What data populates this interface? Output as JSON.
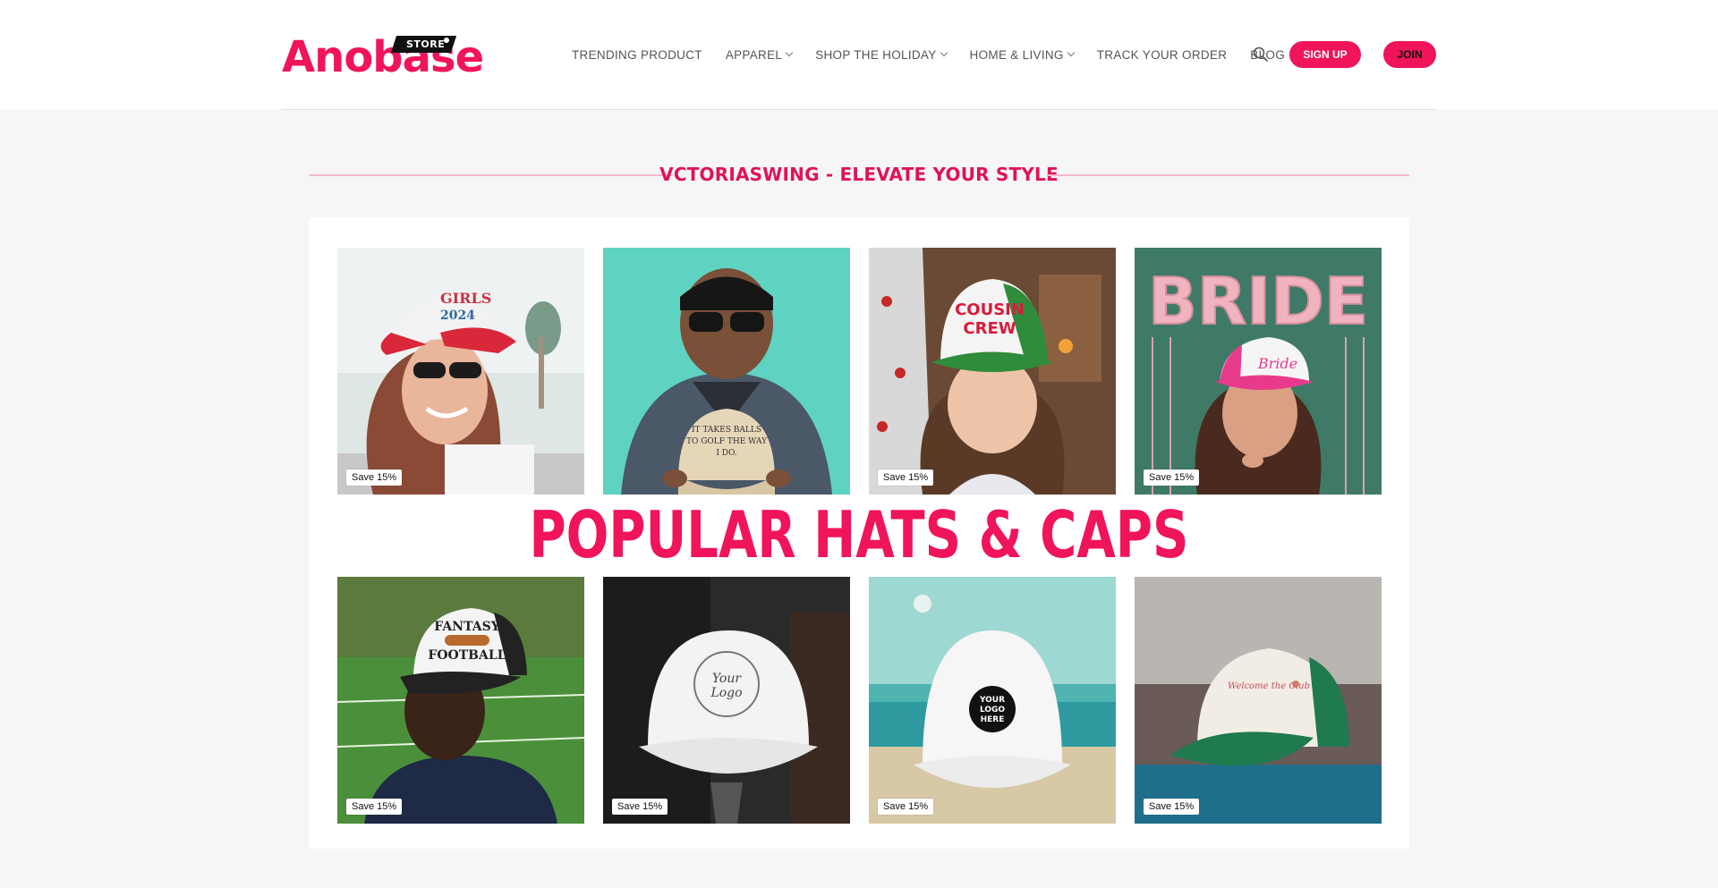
{
  "brand": {
    "name": "Anobase",
    "tag": "STORE"
  },
  "nav": [
    {
      "label": "TRENDING PRODUCT",
      "dropdown": false
    },
    {
      "label": "APPAREL",
      "dropdown": true
    },
    {
      "label": "SHOP THE HOLIDAY",
      "dropdown": true
    },
    {
      "label": "HOME & LIVING",
      "dropdown": true
    },
    {
      "label": "TRACK YOUR ORDER",
      "dropdown": false
    },
    {
      "label": "BLOG",
      "dropdown": false
    }
  ],
  "header": {
    "signup_label": "SIGN UP",
    "join_label": "JOIN",
    "search_icon": "search-icon"
  },
  "section": {
    "title": "VCTORIASWING - ELEVATE YOUR STYLE"
  },
  "banner": {
    "text": "POPULAR HATS & CAPS"
  },
  "products": [
    {
      "image": "woman-red-trucker-hat-girls-trip-2024",
      "badge": "Save 15%"
    },
    {
      "image": "man-holding-khaki-cap-golf-text",
      "badge": ""
    },
    {
      "image": "woman-green-trucker-cousin-crew",
      "badge": "Save 15%"
    },
    {
      "image": "woman-pink-trucker-bride",
      "badge": "Save 15%"
    },
    {
      "image": "man-black-trucker-fantasy-football",
      "badge": "Save 15%"
    },
    {
      "image": "white-cap-your-logo-here",
      "badge": "Save 15%"
    },
    {
      "image": "white-trucker-your-logo-here-beach",
      "badge": "Save 15%"
    },
    {
      "image": "green-white-trucker-on-rail",
      "badge": "Save 15%"
    }
  ],
  "colors": {
    "accent": "#f0145a",
    "background": "#f6f6f6",
    "panel": "#ffffff"
  }
}
